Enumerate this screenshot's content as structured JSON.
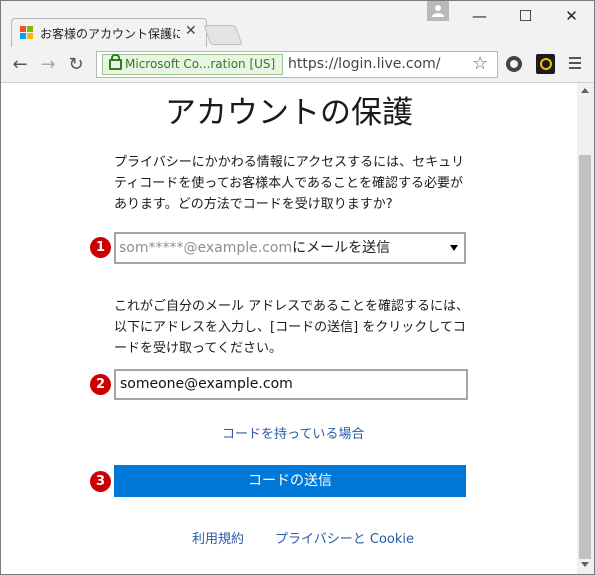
{
  "browser": {
    "tab_title": "お客様のアカウント保護にご協",
    "ev_label": "Microsoft Co...ration [US]",
    "url": "https://login.live.com/",
    "window_min": "—",
    "window_max": "☐",
    "window_close": "✕",
    "tab_close": "✕",
    "back_glyph": "←",
    "forward_glyph": "→",
    "reload_glyph": "↻",
    "star_glyph": "☆"
  },
  "page": {
    "heading": "アカウントの保護",
    "intro": "プライバシーにかかわる情報にアクセスするには、セキュリティコードを使ってお客様本人であることを確認する必要があります。どの方法でコードを受け取りますか?",
    "method_select": {
      "masked_email": "som*****@example.com",
      "suffix": "にメールを送信"
    },
    "confirm_text": "これがご自分のメール アドレスであることを確認するには、以下にアドレスを入力し、[コードの送信] をクリックしてコードを受け取ってください。",
    "email_value": "someone@example.com",
    "have_code_link": "コードを持っている場合",
    "submit_label": "コードの送信",
    "terms_link": "利用規約",
    "privacy_link": "プライバシーと Cookie"
  },
  "annotations": {
    "badge1": "1",
    "badge2": "2",
    "badge3": "3",
    "badge_color": "#cc0000"
  },
  "colors": {
    "accent": "#0078d7",
    "link": "#2a5aa6",
    "ev_green": "#2f7d1f"
  },
  "icons": {
    "favicon": "microsoft-logo-icon",
    "profile": "person-icon",
    "lock": "lock-icon",
    "star": "bookmark-star-icon",
    "ext1": "extension-circle-icon",
    "ext2": "extension-check-icon",
    "menu": "hamburger-menu-icon"
  }
}
